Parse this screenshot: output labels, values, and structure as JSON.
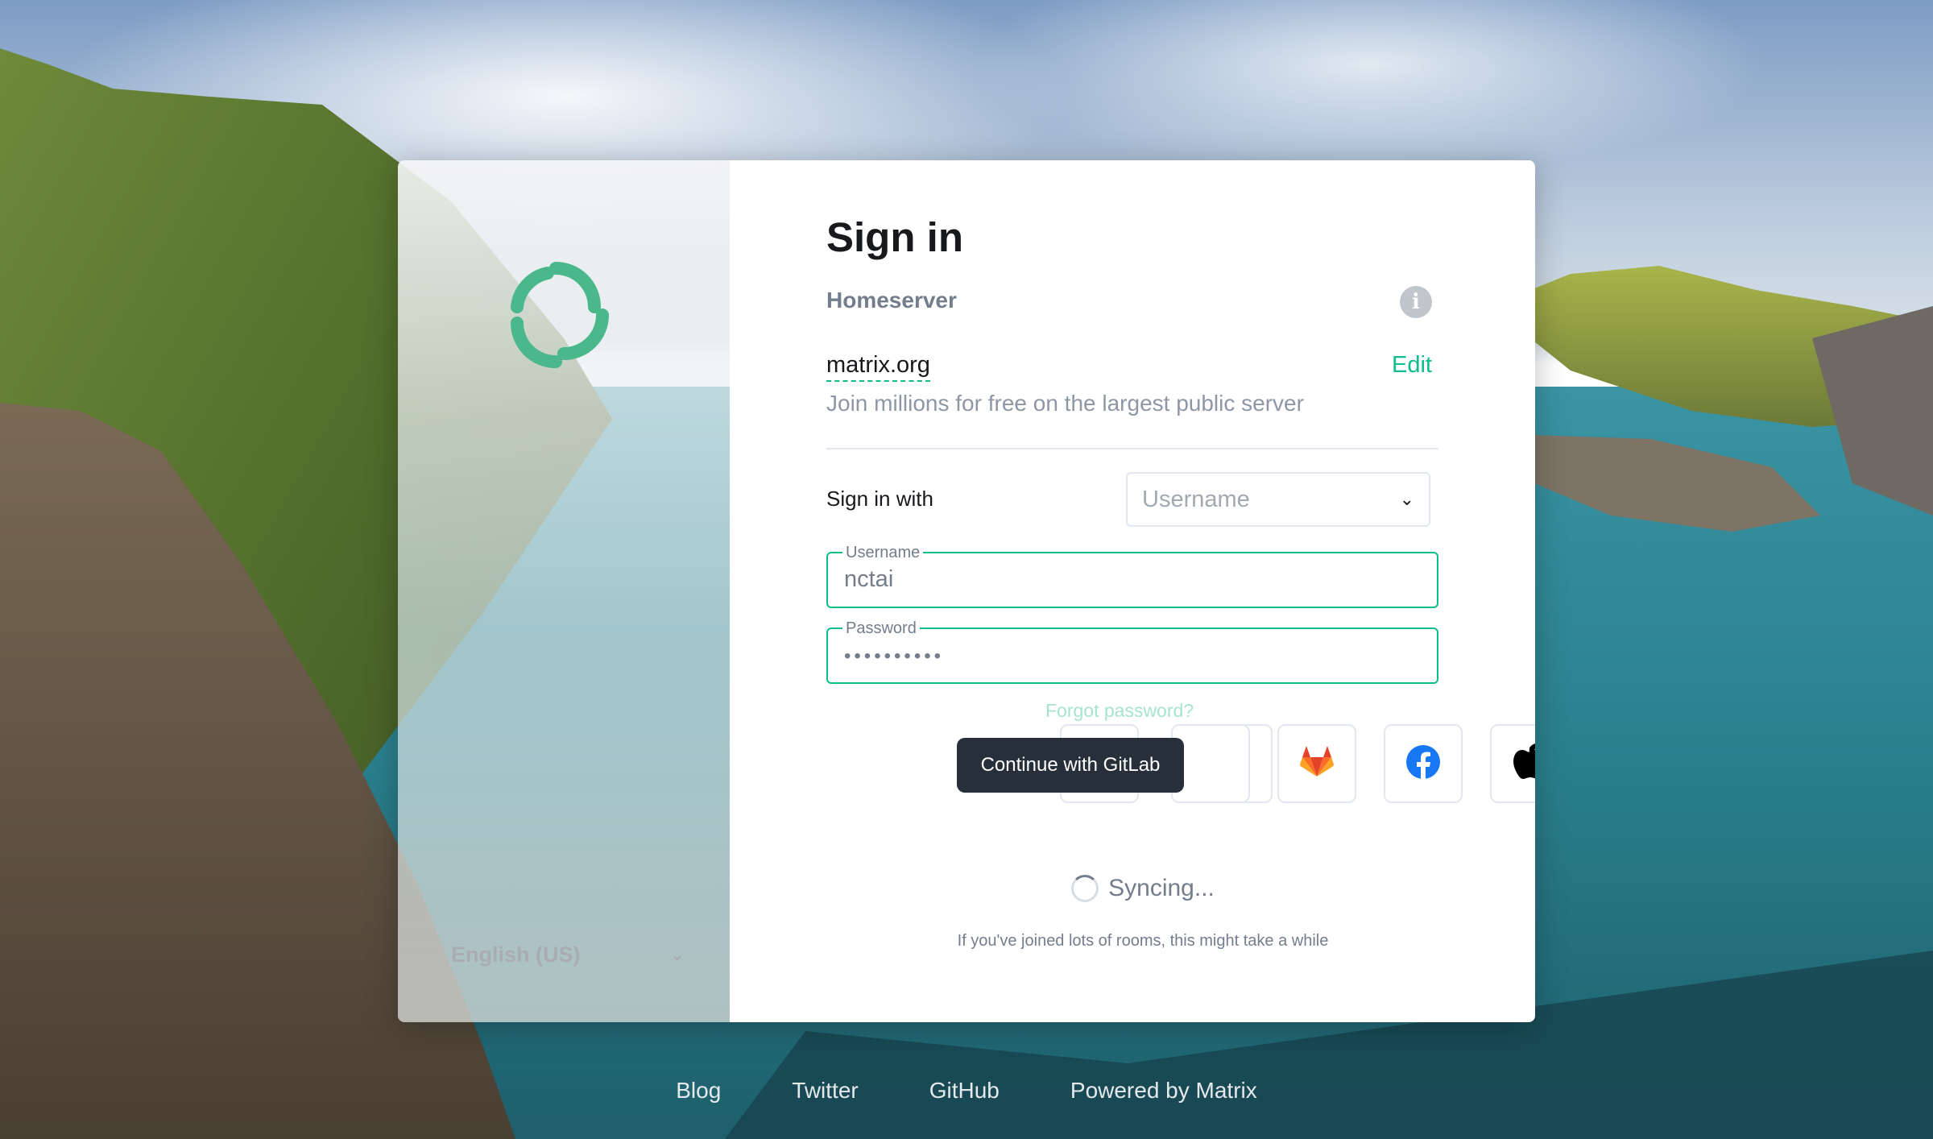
{
  "card": {
    "title": "Sign in",
    "homeserver": {
      "label": "Homeserver",
      "info_icon": "info-icon",
      "name": "matrix.org",
      "edit_label": "Edit",
      "description": "Join millions for free on the largest public server"
    },
    "sign_in_with": {
      "label": "Sign in with",
      "selected": "Username"
    },
    "username_field": {
      "label": "Username",
      "value": "nctai"
    },
    "password_field": {
      "label": "Password",
      "value": "••••••••••"
    },
    "forgot_password": "Forgot password?",
    "sso": {
      "tooltip": "Continue with GitLab",
      "providers": [
        "gitlab-icon",
        "facebook-icon",
        "apple-icon"
      ]
    },
    "syncing": {
      "text": "Syncing...",
      "subtext": "If you've joined lots of rooms, this might take a while"
    }
  },
  "left_panel": {
    "language": "English (US)",
    "logo": "element-logo-icon"
  },
  "footer": {
    "links": [
      "Blog",
      "Twitter",
      "GitHub",
      "Powered by Matrix"
    ]
  },
  "colors": {
    "accent": "#0dbd8b",
    "text_primary": "#17191c",
    "text_secondary": "#737d8c",
    "tooltip_bg": "#27303a"
  }
}
